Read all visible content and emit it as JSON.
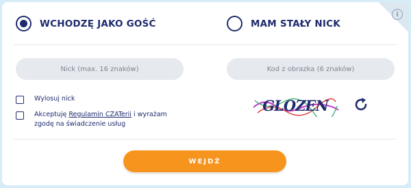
{
  "options": {
    "guest_label": "WCHODZĘ JAKO GOŚĆ",
    "guest_selected": true,
    "nick_label": "MAM STAŁY NICK",
    "nick_selected": false
  },
  "inputs": {
    "nick_placeholder": "Nick (max. 16 znaków)",
    "captcha_placeholder": "Kod z obrazka (6 znaków)"
  },
  "checkboxes": {
    "random_nick_label": "Wylosuj nick",
    "terms_prefix": "Akceptuję ",
    "terms_link": "Regulamin CZATerii",
    "terms_suffix": " i wyrażam zgodę na świadczenie usług"
  },
  "captcha": {
    "text": "GLOZEN"
  },
  "icons": {
    "info": "info-icon",
    "refresh": "refresh-icon"
  },
  "submit": {
    "label": "WEJDŹ"
  },
  "colors": {
    "navy": "#1f2b6e",
    "orange": "#f7941d",
    "field_bg": "#e6e9ee"
  }
}
